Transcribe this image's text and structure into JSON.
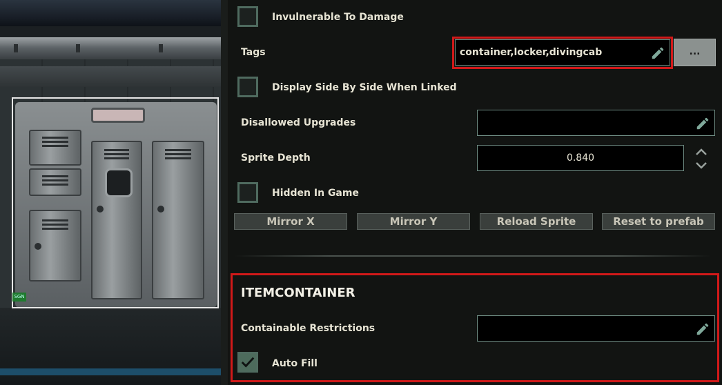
{
  "properties": {
    "invulnerable_label": "Invulnerable To Damage",
    "tags_label": "Tags",
    "tags_value": "container,locker,divingcab",
    "tags_more_label": "...",
    "display_side_label": "Display Side By Side When Linked",
    "disallowed_upgrades_label": "Disallowed Upgrades",
    "disallowed_upgrades_value": "",
    "sprite_depth_label": "Sprite Depth",
    "sprite_depth_value": "0.840",
    "hidden_in_game_label": "Hidden In Game"
  },
  "buttons": {
    "mirror_x": "Mirror X",
    "mirror_y": "Mirror Y",
    "reload_sprite": "Reload Sprite",
    "reset_prefab": "Reset to prefab"
  },
  "itemcontainer": {
    "title": "ITEMCONTAINER",
    "containable_label": "Containable Restrictions",
    "containable_value": "",
    "auto_fill_label": "Auto Fill"
  },
  "scene": {
    "gauge_text": "SGN"
  },
  "colors": {
    "accent": "#4f6b5f",
    "highlight": "#d11919",
    "text": "#e7e4d4"
  }
}
